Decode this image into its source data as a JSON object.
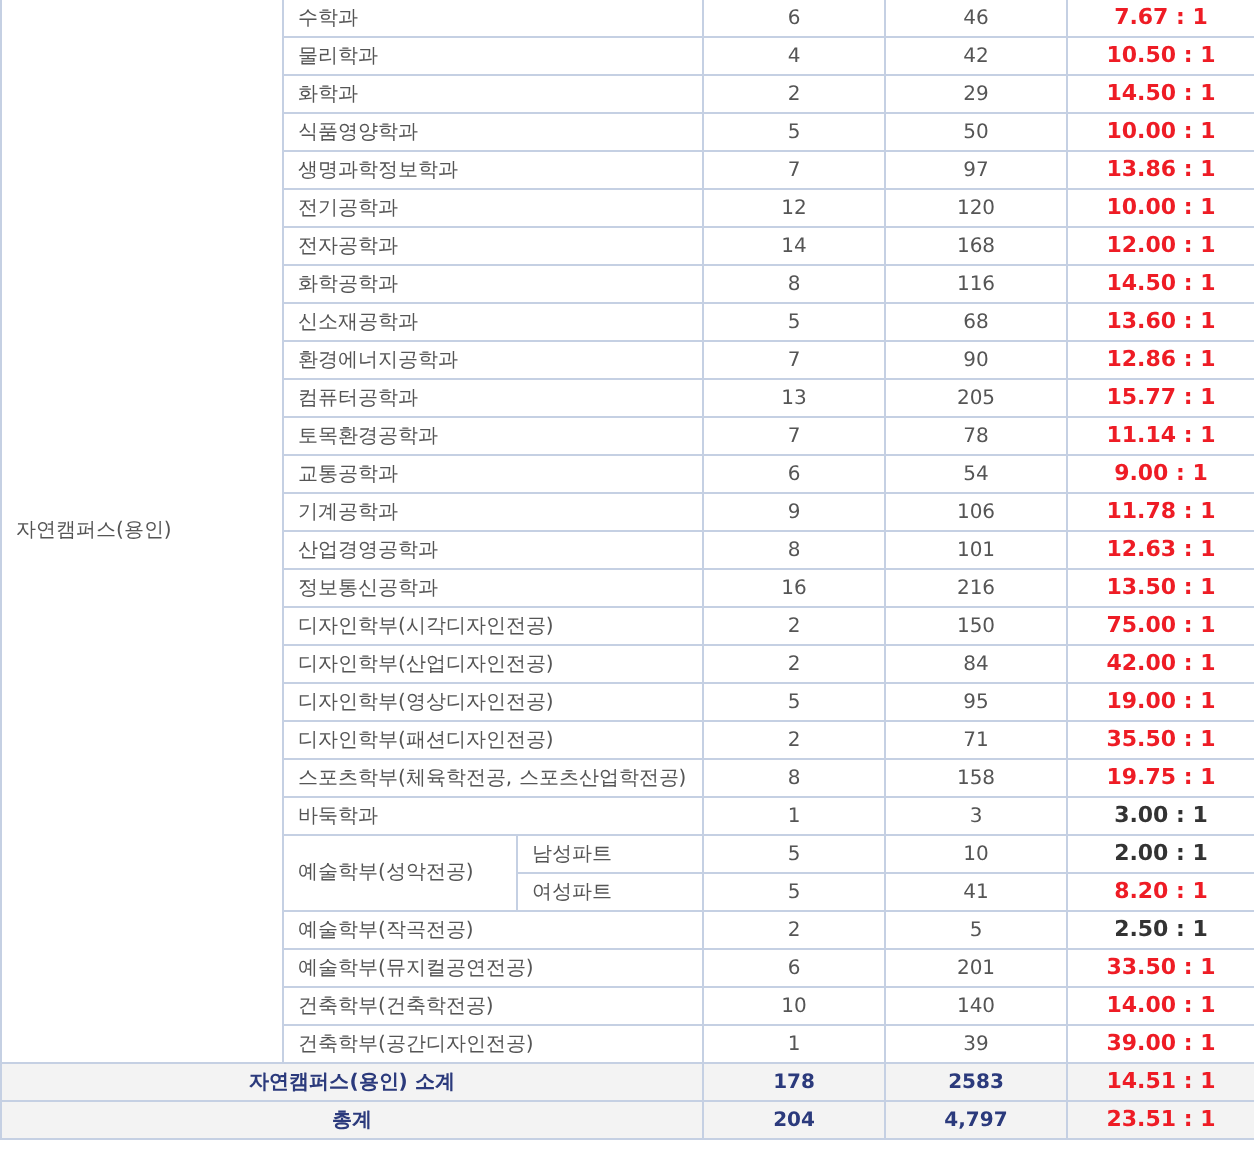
{
  "table": {
    "campus": "자연캠퍼스(용인)",
    "rows": [
      {
        "department": "수학과",
        "quota": "6",
        "applicants": "46",
        "ratio": "7.67 : 1",
        "highlight": true
      },
      {
        "department": "물리학과",
        "quota": "4",
        "applicants": "42",
        "ratio": "10.50 : 1",
        "highlight": true
      },
      {
        "department": "화학과",
        "quota": "2",
        "applicants": "29",
        "ratio": "14.50 : 1",
        "highlight": true
      },
      {
        "department": "식품영양학과",
        "quota": "5",
        "applicants": "50",
        "ratio": "10.00 : 1",
        "highlight": true
      },
      {
        "department": "생명과학정보학과",
        "quota": "7",
        "applicants": "97",
        "ratio": "13.86 : 1",
        "highlight": true
      },
      {
        "department": "전기공학과",
        "quota": "12",
        "applicants": "120",
        "ratio": "10.00 : 1",
        "highlight": true
      },
      {
        "department": "전자공학과",
        "quota": "14",
        "applicants": "168",
        "ratio": "12.00 : 1",
        "highlight": true
      },
      {
        "department": "화학공학과",
        "quota": "8",
        "applicants": "116",
        "ratio": "14.50 : 1",
        "highlight": true
      },
      {
        "department": "신소재공학과",
        "quota": "5",
        "applicants": "68",
        "ratio": "13.60 : 1",
        "highlight": true
      },
      {
        "department": "환경에너지공학과",
        "quota": "7",
        "applicants": "90",
        "ratio": "12.86 : 1",
        "highlight": true
      },
      {
        "department": "컴퓨터공학과",
        "quota": "13",
        "applicants": "205",
        "ratio": "15.77 : 1",
        "highlight": true
      },
      {
        "department": "토목환경공학과",
        "quota": "7",
        "applicants": "78",
        "ratio": "11.14 : 1",
        "highlight": true
      },
      {
        "department": "교통공학과",
        "quota": "6",
        "applicants": "54",
        "ratio": "9.00 : 1",
        "highlight": true
      },
      {
        "department": "기계공학과",
        "quota": "9",
        "applicants": "106",
        "ratio": "11.78 : 1",
        "highlight": true
      },
      {
        "department": "산업경영공학과",
        "quota": "8",
        "applicants": "101",
        "ratio": "12.63 : 1",
        "highlight": true
      },
      {
        "department": "정보통신공학과",
        "quota": "16",
        "applicants": "216",
        "ratio": "13.50 : 1",
        "highlight": true
      },
      {
        "department": "디자인학부(시각디자인전공)",
        "quota": "2",
        "applicants": "150",
        "ratio": "75.00 : 1",
        "highlight": true
      },
      {
        "department": "디자인학부(산업디자인전공)",
        "quota": "2",
        "applicants": "84",
        "ratio": "42.00 : 1",
        "highlight": true
      },
      {
        "department": "디자인학부(영상디자인전공)",
        "quota": "5",
        "applicants": "95",
        "ratio": "19.00 : 1",
        "highlight": true
      },
      {
        "department": "디자인학부(패션디자인전공)",
        "quota": "2",
        "applicants": "71",
        "ratio": "35.50 : 1",
        "highlight": true
      },
      {
        "department": "스포츠학부(체육학전공, 스포츠산업학전공)",
        "quota": "8",
        "applicants": "158",
        "ratio": "19.75 : 1",
        "highlight": true
      },
      {
        "department": "바둑학과",
        "quota": "1",
        "applicants": "3",
        "ratio": "3.00 : 1",
        "highlight": false
      },
      {
        "department": "예술학부(성악전공)",
        "parts": [
          {
            "part": "남성파트",
            "quota": "5",
            "applicants": "10",
            "ratio": "2.00 : 1",
            "highlight": false
          },
          {
            "part": "여성파트",
            "quota": "5",
            "applicants": "41",
            "ratio": "8.20 : 1",
            "highlight": true
          }
        ]
      },
      {
        "department": "예술학부(작곡전공)",
        "quota": "2",
        "applicants": "5",
        "ratio": "2.50 : 1",
        "highlight": false
      },
      {
        "department": "예술학부(뮤지컬공연전공)",
        "quota": "6",
        "applicants": "201",
        "ratio": "33.50 : 1",
        "highlight": true
      },
      {
        "department": "건축학부(건축학전공)",
        "quota": "10",
        "applicants": "140",
        "ratio": "14.00 : 1",
        "highlight": true
      },
      {
        "department": "건축학부(공간디자인전공)",
        "quota": "1",
        "applicants": "39",
        "ratio": "39.00 : 1",
        "highlight": true
      }
    ],
    "totals": [
      {
        "label": "자연캠퍼스(용인) 소계",
        "quota": "178",
        "applicants": "2583",
        "ratio": "14.51 : 1",
        "highlight": true
      },
      {
        "label": "총계",
        "quota": "204",
        "applicants": "4,797",
        "ratio": "23.51 : 1",
        "highlight": true
      }
    ]
  }
}
